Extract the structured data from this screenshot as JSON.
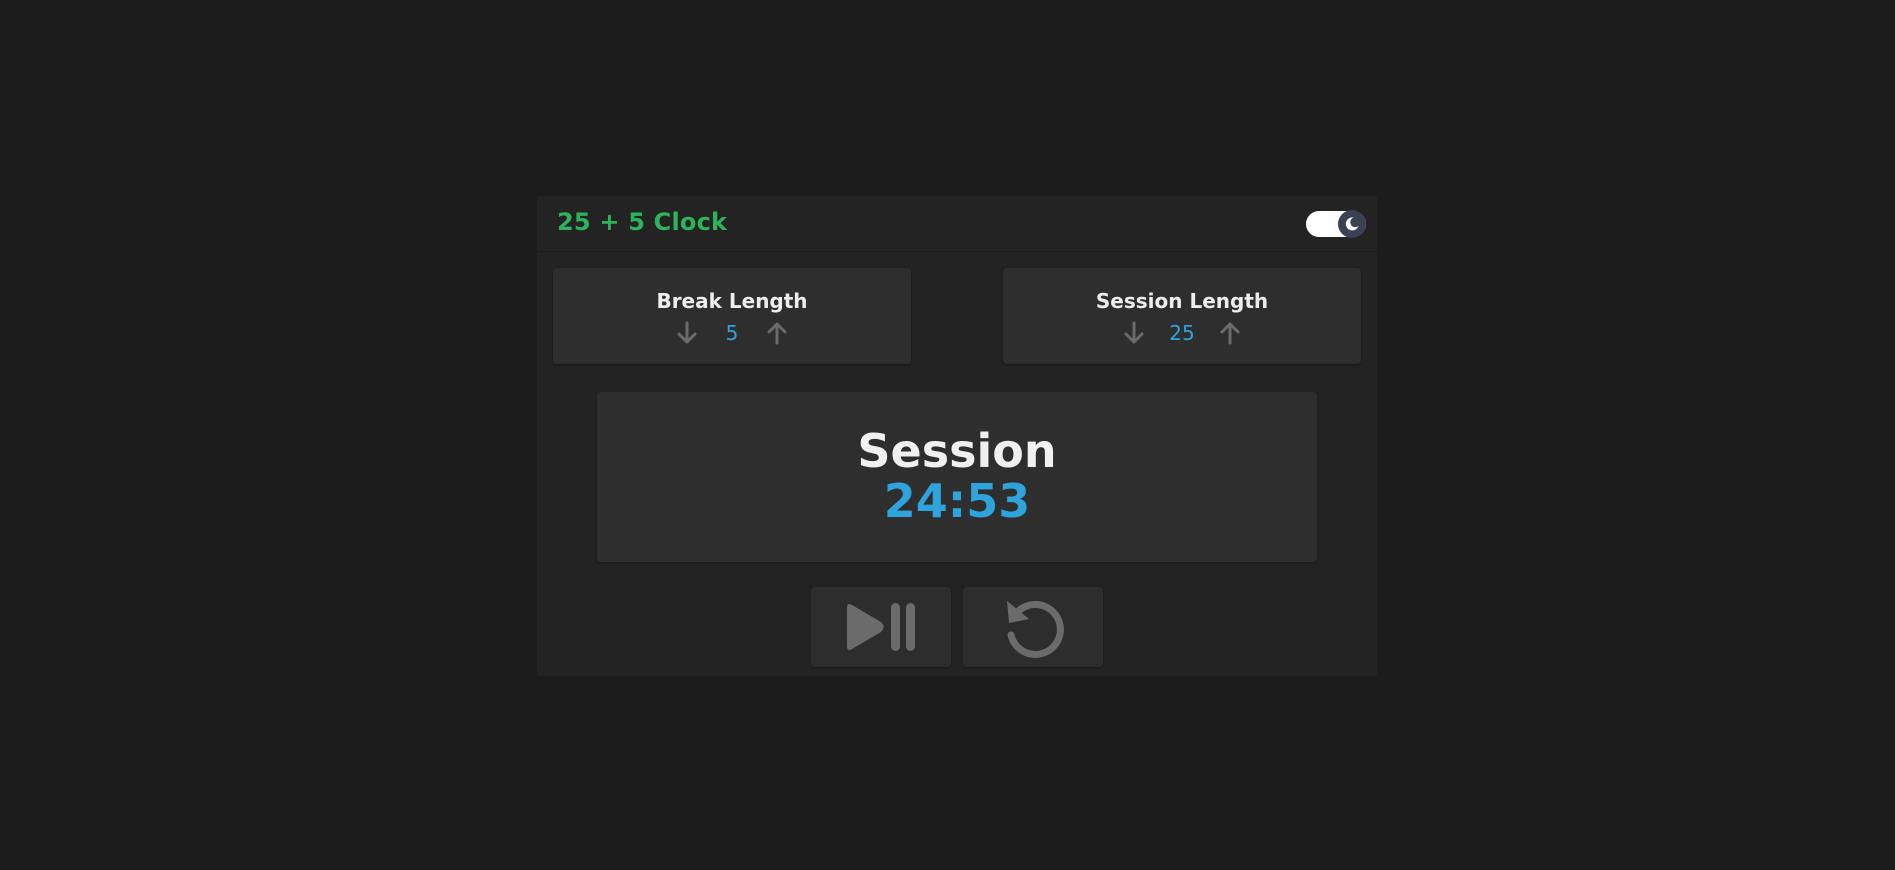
{
  "header": {
    "title": "25 + 5 Clock",
    "theme_toggle": {
      "icon": "moon-icon",
      "state": "dark"
    }
  },
  "break": {
    "label": "Break Length",
    "value": "5",
    "decrement_icon": "arrow-down-icon",
    "increment_icon": "arrow-up-icon"
  },
  "session": {
    "label": "Session Length",
    "value": "25",
    "decrement_icon": "arrow-down-icon",
    "increment_icon": "arrow-up-icon"
  },
  "timer": {
    "label": "Session",
    "time": "24:53"
  },
  "controls": {
    "play_pause_icon": "play-pause-icon",
    "reset_icon": "reset-icon"
  },
  "colors": {
    "background": "#1c1c1c",
    "panel": "#232323",
    "card": "#2e2e2e",
    "title_green": "#2db35a",
    "accent_blue": "#2fa3dc",
    "icon_gray": "#6b6b6b"
  }
}
